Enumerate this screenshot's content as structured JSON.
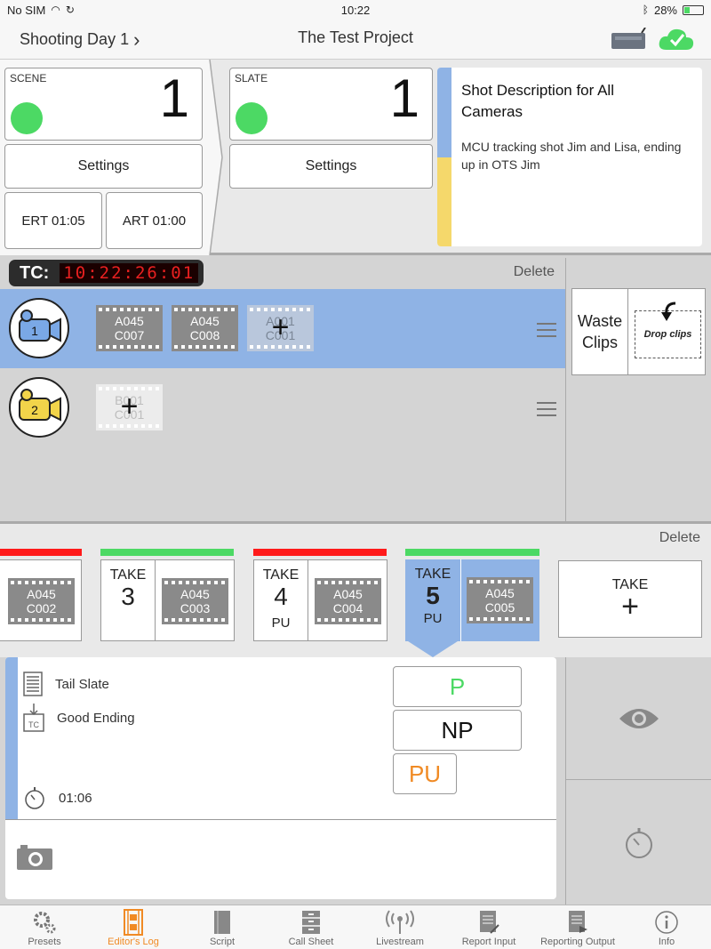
{
  "status_bar": {
    "carrier": "No SIM",
    "time": "10:22",
    "battery": "28%"
  },
  "nav": {
    "back_label": "Shooting Day 1",
    "title": "The Test Project"
  },
  "scene": {
    "label": "SCENE",
    "value": "1",
    "settings_label": "Settings",
    "ert": "ERT 01:05",
    "art": "ART 01:00"
  },
  "slate": {
    "label": "SLATE",
    "value": "1",
    "settings_label": "Settings"
  },
  "shot_description": {
    "title": "Shot Description for All Cameras",
    "text": "MCU tracking shot Jim and Lisa, ending up in OTS Jim"
  },
  "timecode": {
    "label": "TC:",
    "value": "10:22:26:01"
  },
  "cameras_delete": "Delete",
  "cameras": [
    {
      "number": "1",
      "color": "#7aa8e6",
      "clips": [
        "A045\nC007",
        "A045\nC008"
      ],
      "next_clip": "A001\nC001"
    },
    {
      "number": "2",
      "color": "#f2d44a",
      "clips": [],
      "next_clip": "B001\nC001"
    }
  ],
  "waste": {
    "label": "Waste Clips",
    "drop_label": "Drop clips"
  },
  "takes_delete": "Delete",
  "takes": [
    {
      "word": "",
      "number": "",
      "pu": "",
      "clip": "A045\nC002",
      "status_color": "#ff1a1a"
    },
    {
      "word": "TAKE",
      "number": "3",
      "pu": "",
      "clip": "A045\nC003",
      "status_color": "#4cd964"
    },
    {
      "word": "TAKE",
      "number": "4",
      "pu": "PU",
      "clip": "A045\nC004",
      "status_color": "#ff1a1a"
    },
    {
      "word": "TAKE",
      "number": "5",
      "pu": "PU",
      "clip": "A045\nC005",
      "status_color": "#4cd964"
    }
  ],
  "new_take": {
    "label": "TAKE",
    "plus": "+"
  },
  "take_detail": {
    "tail_slate": "Tail Slate",
    "good_ending": "Good Ending",
    "duration": "01:06",
    "tc_icon_label": "TC",
    "status_buttons": {
      "p": "P",
      "np": "NP",
      "pu": "PU"
    }
  },
  "colors": {
    "accent_orange": "#f08a24",
    "p_green": "#4cd964",
    "selected_blue": "#8fb3e5"
  },
  "tabs": [
    {
      "label": "Presets",
      "icon": "gears-icon"
    },
    {
      "label": "Editor's Log",
      "icon": "film-icon"
    },
    {
      "label": "Script",
      "icon": "book-icon"
    },
    {
      "label": "Call Sheet",
      "icon": "cabinet-icon"
    },
    {
      "label": "Livestream",
      "icon": "antenna-icon"
    },
    {
      "label": "Report Input",
      "icon": "report-icon"
    },
    {
      "label": "Reporting Output",
      "icon": "report-output-icon"
    },
    {
      "label": "Info",
      "icon": "info-icon"
    }
  ],
  "active_tab": 1
}
